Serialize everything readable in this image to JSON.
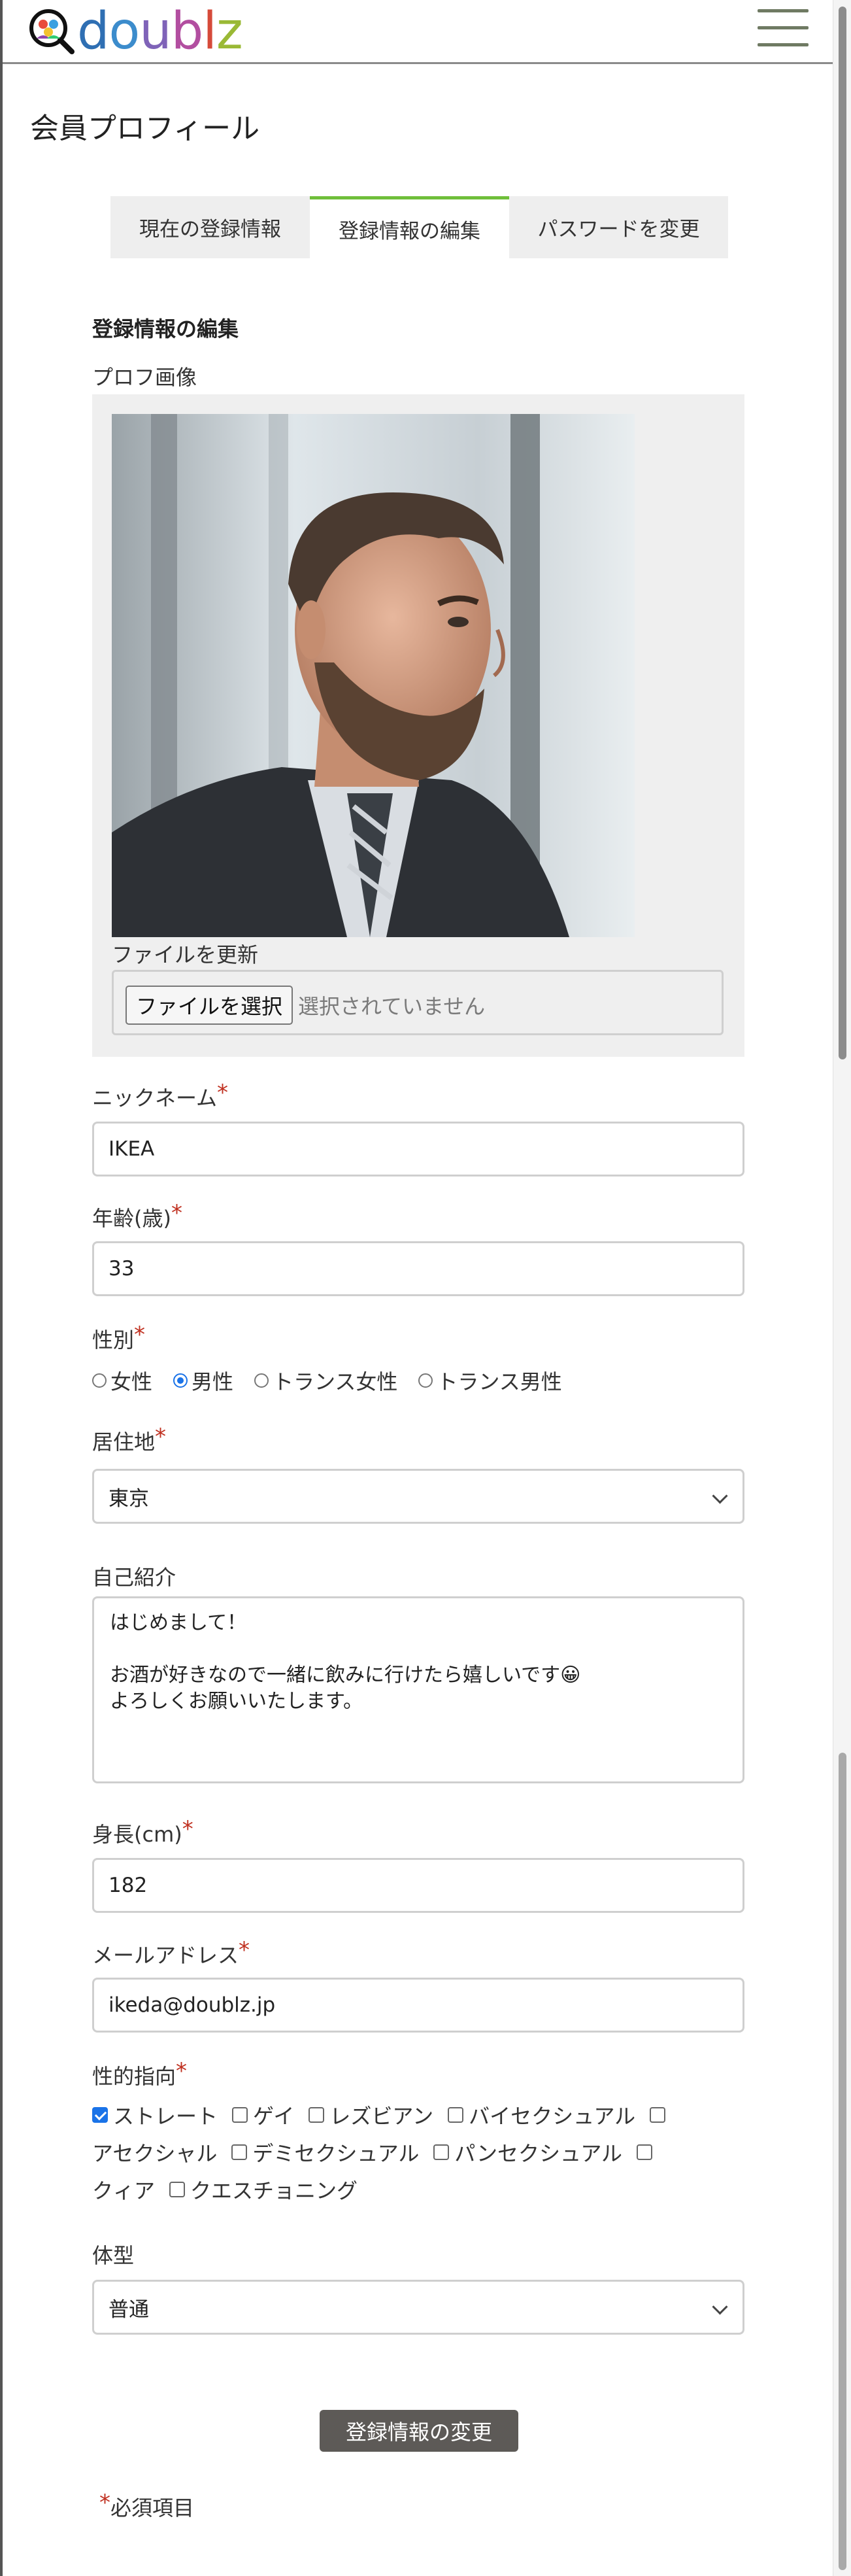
{
  "brand": {
    "name": "doublz"
  },
  "page_title": "会員プロフィール",
  "tabs": [
    {
      "label": "現在の登録情報",
      "active": false
    },
    {
      "label": "登録情報の編集",
      "active": true
    },
    {
      "label": "パスワードを変更",
      "active": false
    }
  ],
  "form": {
    "section_title": "登録情報の編集",
    "photo": {
      "label": "プロフ画像",
      "update_label": "ファイルを更新",
      "choose_button": "ファイルを選択",
      "file_status": "選択されていません"
    },
    "nickname": {
      "label": "ニックネーム",
      "value": "IKEA"
    },
    "age": {
      "label": "年齢(歳)",
      "value": "33"
    },
    "gender": {
      "label": "性別",
      "options": [
        "女性",
        "男性",
        "トランス女性",
        "トランス男性"
      ],
      "selected": "男性"
    },
    "residence": {
      "label": "居住地",
      "value": "東京"
    },
    "bio": {
      "label": "自己紹介",
      "value": "はじめまして！\n\nお酒が好きなので一緒に飲みに行けたら嬉しいです😀\nよろしくお願いいたします。"
    },
    "height": {
      "label": "身長(cm)",
      "value": "182"
    },
    "email": {
      "label": "メールアドレス",
      "value": "ikeda@doublz.jp"
    },
    "orientation": {
      "label": "性的指向",
      "options": [
        "ストレート",
        "ゲイ",
        "レズビアン",
        "バイセクシュアル",
        "アセクシャル",
        "デミセクシュアル",
        "パンセクシュアル",
        "クィア",
        "クエスチョニング"
      ],
      "checked": [
        "ストレート"
      ]
    },
    "body_type": {
      "label": "体型",
      "value": "普通"
    },
    "submit_label": "登録情報の変更",
    "required_mark": "*",
    "required_note": "必須項目"
  },
  "colors": {
    "accent_tab": "#6fbf3a",
    "required": "#c03020",
    "checked": "#1a73e8",
    "button": "#5d5a57"
  }
}
